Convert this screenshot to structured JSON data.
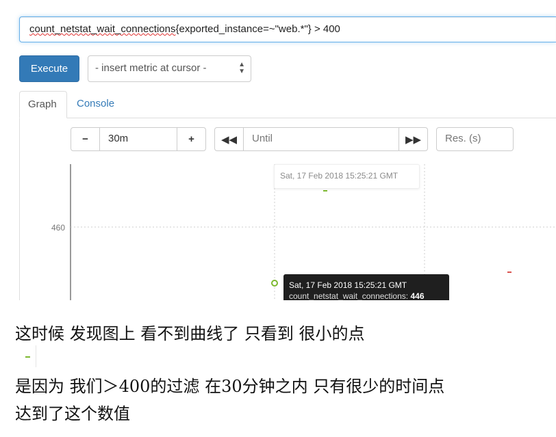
{
  "query": {
    "metric_name": "count_netstat_wait_connections",
    "rest": "{exported_instance=~\"web.*\"} > 400"
  },
  "toolbar": {
    "execute_label": "Execute",
    "metric_select_value": "- insert metric at cursor -"
  },
  "tabs": [
    {
      "label": "Graph",
      "active": true
    },
    {
      "label": "Console",
      "active": false
    }
  ],
  "graph_controls": {
    "range_minus": "−",
    "range_value": "30m",
    "range_plus": "+",
    "back_icon": "double-left-arrow-icon",
    "until_placeholder": "Until",
    "forward_icon": "double-right-arrow-icon",
    "resolution_placeholder": "Res. (s)"
  },
  "graph": {
    "y_tick_label": "460",
    "hover_time": "Sat, 17 Feb 2018 15:25:21 GMT",
    "tooltip": {
      "time": "Sat, 17 Feb 2018 15:25:21 GMT",
      "metric": "count_netstat_wait_connections:",
      "value": "446"
    },
    "colors": {
      "green": "#7cb82f",
      "red": "#d9534f"
    }
  },
  "chart_data": {
    "type": "scatter",
    "y_ticks": [
      460
    ],
    "points": [
      {
        "color": "green",
        "note": "short segment near top"
      },
      {
        "color": "green",
        "value": 446,
        "time": "Sat, 17 Feb 2018 15:25:21 GMT"
      },
      {
        "color": "red",
        "note": "short segment at right edge"
      }
    ]
  },
  "notes": {
    "line1": "这时候 发现图上 看不到曲线了 只看到 很小的点",
    "line2": "是因为 我们＞400的过滤 在30分钟之内 只有很少的时间点",
    "line3": "达到了这个数值"
  }
}
